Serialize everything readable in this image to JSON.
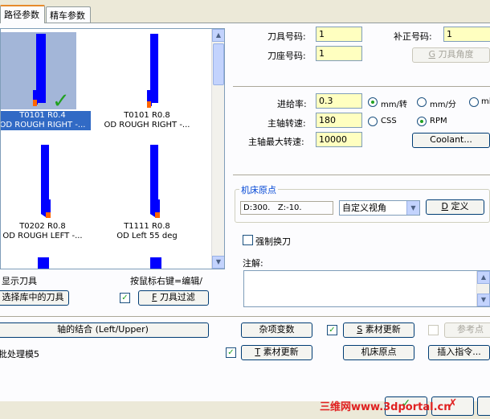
{
  "tabs": [
    {
      "label": "路径参数",
      "active": true
    },
    {
      "label": "精车参数",
      "active": false
    }
  ],
  "tools": [
    {
      "id": "T0101 R0.4",
      "desc": "OD ROUGH RIGHT -...",
      "selected": true
    },
    {
      "id": "T0101 R0.8",
      "desc": "OD ROUGH RIGHT -...",
      "selected": false
    },
    {
      "id": "T0202 R0.8",
      "desc": "OD ROUGH LEFT -...",
      "selected": false
    },
    {
      "id": "T1111 R0.8",
      "desc": "OD Left 55 deg",
      "selected": false
    }
  ],
  "list_footer": {
    "show_tools": "显示刀具",
    "hint": "按鼠标右键=编辑/",
    "select_lib_btn": "选择库中的刀具",
    "filter_btn": "刀具过滤",
    "filter_key": "F"
  },
  "tool_fields": {
    "tool_number_label": "刀具号码:",
    "tool_number": "1",
    "holder_number_label": "刀座号码:",
    "holder_number": "1",
    "offset_number_label": "补正号码:",
    "offset_number": "1",
    "tool_angle_btn": "刀具角度",
    "tool_angle_key": "G"
  },
  "feed": {
    "feed_rate_label": "进给率:",
    "feed_rate": "0.3",
    "unit_per_rev": "mm/转",
    "unit_per_min": "mm/分",
    "unit_extra": "mi",
    "spindle_label": "主轴转速:",
    "spindle": "180",
    "css": "CSS",
    "rpm": "RPM",
    "max_spindle_label": "主轴最大转速:",
    "max_spindle": "10000",
    "coolant_btn": "Coolant..."
  },
  "machine_origin": {
    "title": "机床原点",
    "coords": "D:300.   Z:-10.",
    "view": "自定义视角",
    "define_btn": "定义",
    "define_key": "D"
  },
  "force_change": "强制换刀",
  "notes_label": "注解:",
  "actions": {
    "axis_combo": "轴的结合 (Left/Upper)",
    "batch": "批处理模5",
    "misc_vars": "杂项变数",
    "stock_update": "素材更新",
    "stock_key": "S",
    "ref_point": "参考点",
    "stock_update2": "素材更新",
    "stock_key2": "T",
    "machine_origin_btn": "机床原点",
    "insert_cmd": "插入指令..."
  },
  "watermark": "三维网www.3dportal.cn",
  "colors": {
    "tool_blue": "#0000ff",
    "tool_tip": "#ff6600",
    "selection": "#316ac5",
    "input_bg": "#ffffc0",
    "check_green": "#21a121"
  }
}
